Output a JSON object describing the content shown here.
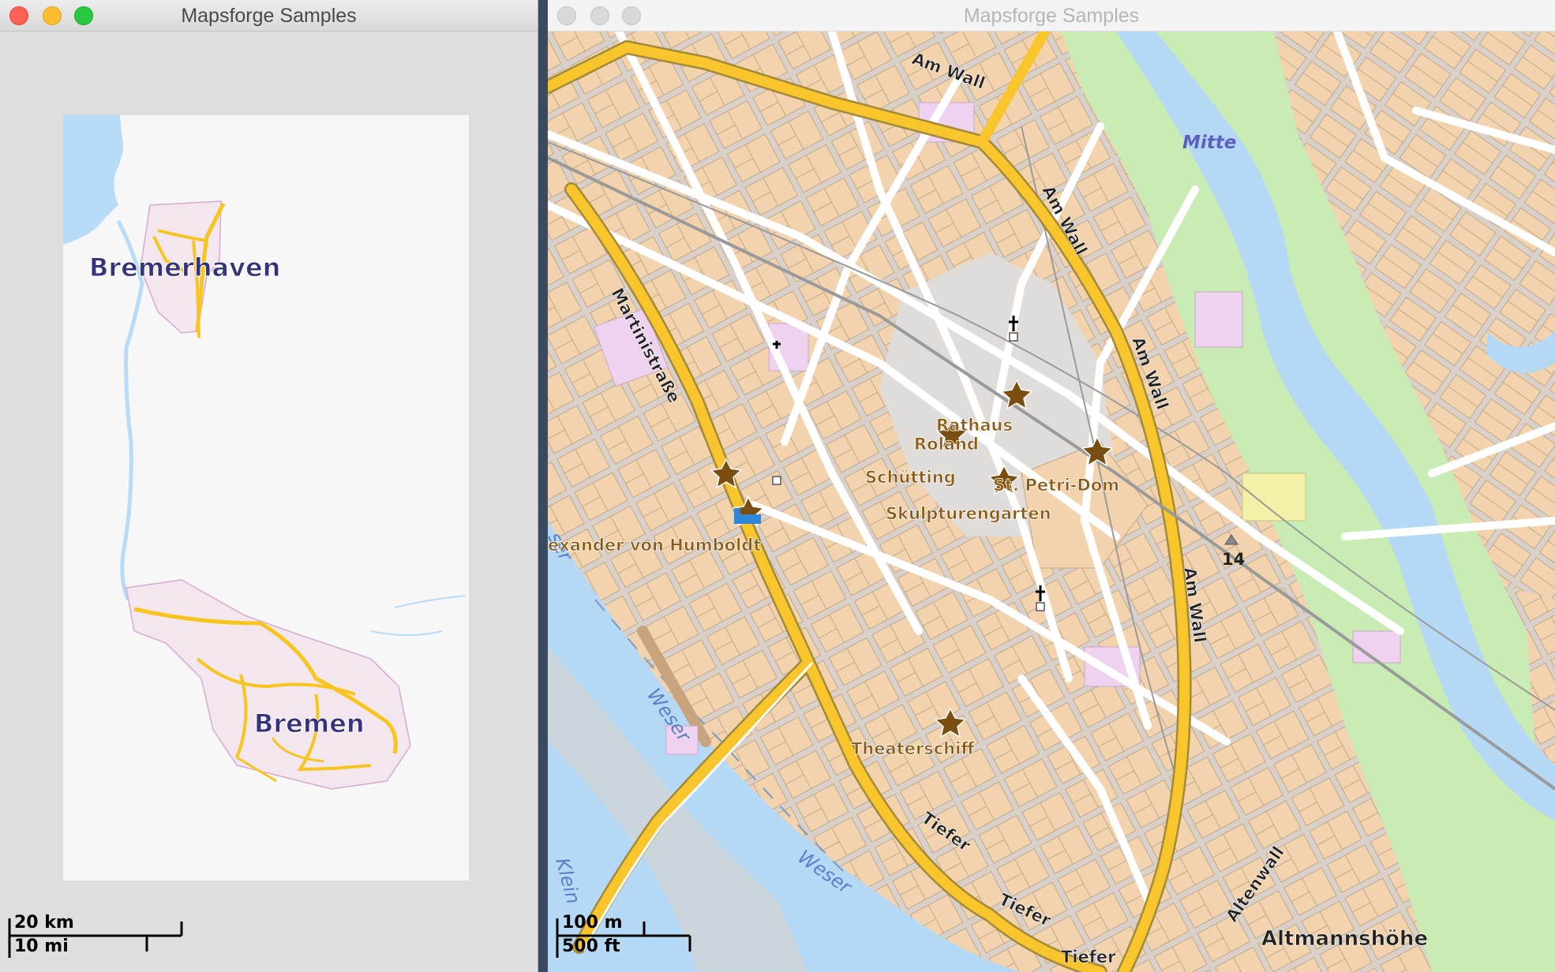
{
  "left_window": {
    "title": "Mapsforge Samples",
    "traffic_lights": [
      "close",
      "minimize",
      "zoom"
    ],
    "map": {
      "places": [
        "Bremerhaven",
        "Bremen"
      ]
    },
    "scale": {
      "metric": "20 km",
      "imperial": "10 mi"
    }
  },
  "right_window": {
    "title": "Mapsforge Samples",
    "map": {
      "streets": [
        "Am Wall",
        "Am Wall",
        "Am Wall",
        "Am Wall",
        "Martinistraße",
        "Tiefer",
        "Tiefer",
        "Tiefer",
        "Altenwall"
      ],
      "water": [
        "Weser",
        "Weser",
        "ser",
        "Klein"
      ],
      "districts": [
        "Mitte",
        "Altmannshöhe"
      ],
      "pois": [
        "Rathaus",
        "Roland",
        "Schütting",
        "St. Petri-Dom",
        "Skulpturengarten",
        "exander von Humboldt",
        "Theaterschiff"
      ],
      "elevation": "14"
    },
    "scale": {
      "metric": "100 m",
      "imperial": "500 ft"
    }
  },
  "colors": {
    "building": "#f2d3ae",
    "road": "#ffffff",
    "major_road": "#f9c52c",
    "water": "#b5d8f5",
    "park": "#c8ecb3",
    "poi_text": "#8b5a14",
    "place_text": "#35337a"
  }
}
